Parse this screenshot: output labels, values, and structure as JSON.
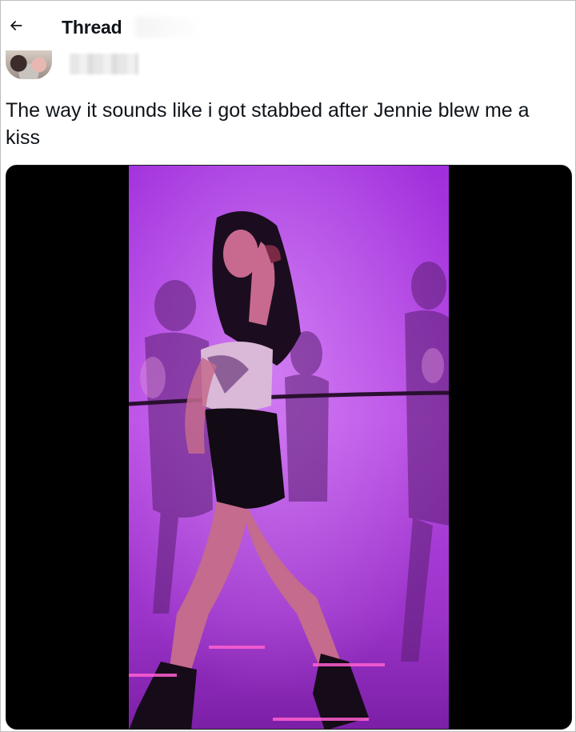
{
  "header": {
    "back_icon": "arrow-left-icon",
    "title": "Thread"
  },
  "author": {
    "avatar_icon": "avatar-photo",
    "name_redacted": true
  },
  "tweet": {
    "text": "The way it sounds like i got stabbed after Jennie blew me a kiss"
  },
  "media": {
    "type": "video",
    "dominant_color": "#b13be0"
  }
}
